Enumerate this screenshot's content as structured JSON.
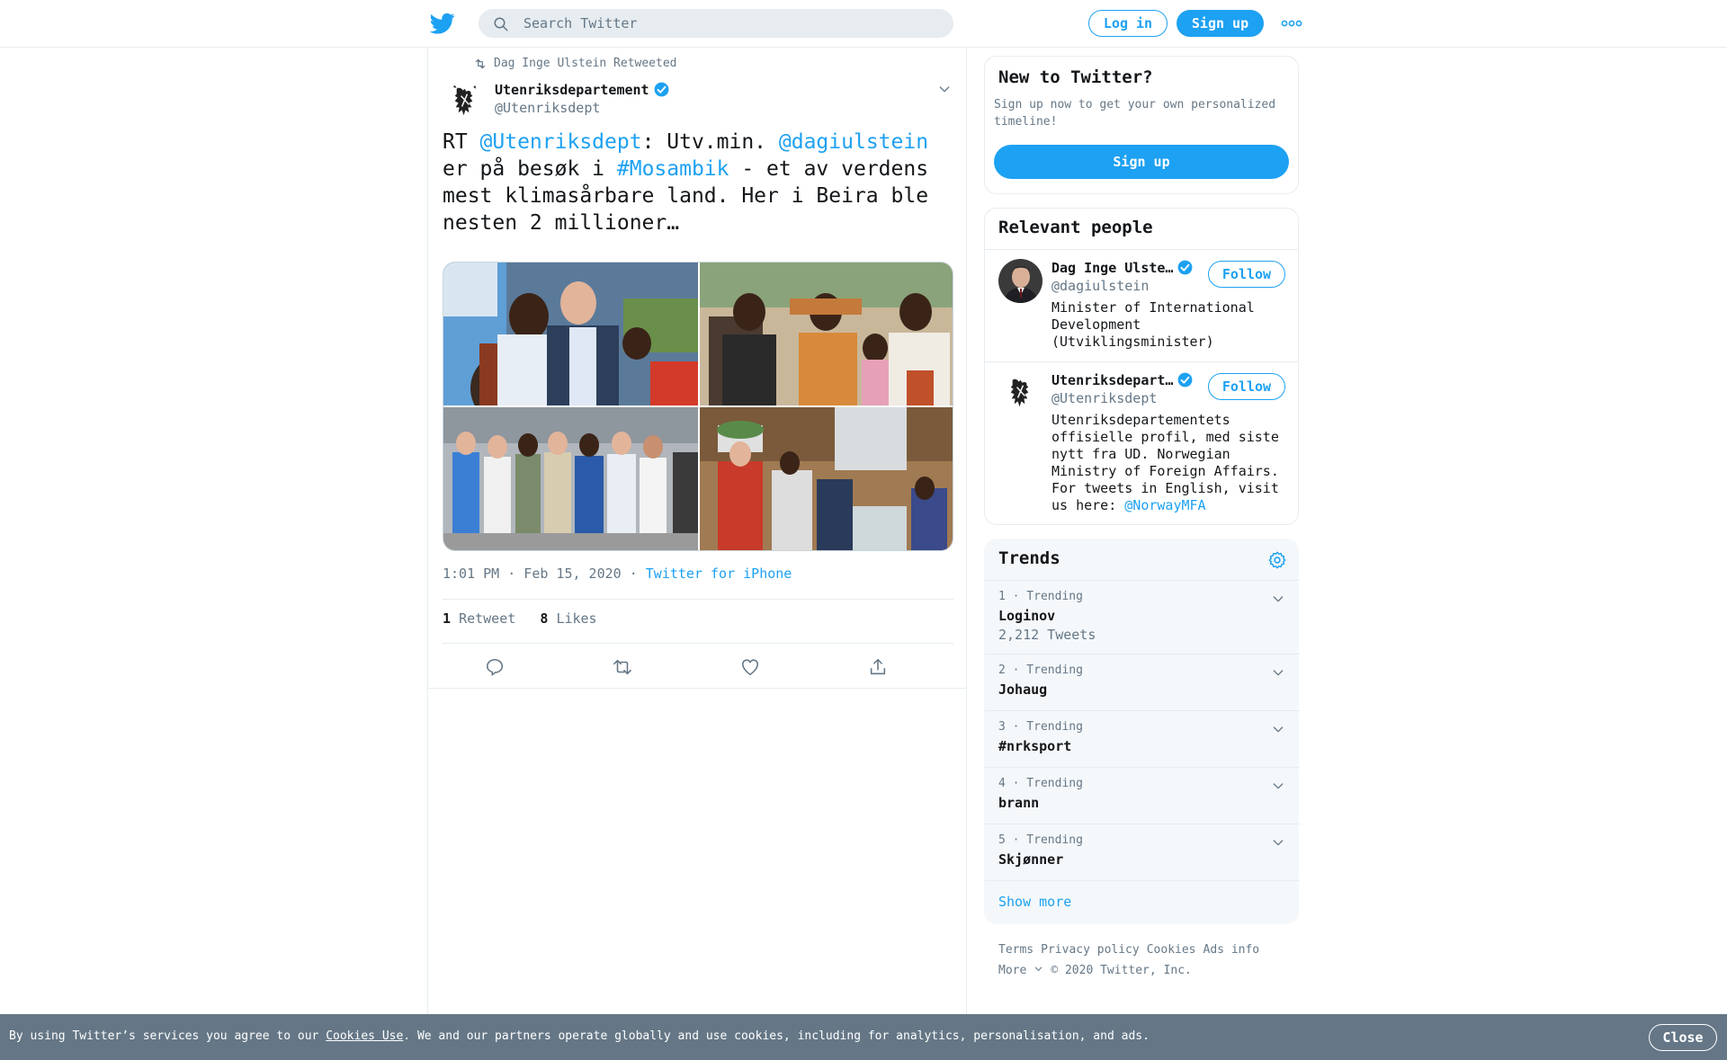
{
  "header": {
    "search_placeholder": "Search Twitter",
    "login_label": "Log in",
    "signup_label": "Sign up"
  },
  "tweet": {
    "retweeted_by": "Dag Inge Ulstein Retweeted",
    "author_name": "Utenriksdepartement",
    "author_handle": "@Utenriksdept",
    "text_parts": {
      "p1": "RT ",
      "m1": "@Utenriksdept",
      "p2": ": Utv.min. ",
      "m2": "@dagiulstein",
      "p3": " er på besøk i ",
      "h1": "#Mosambik",
      "p4": " - et av verdens mest klimasårbare land. Her i Beira ble nesten 2 millioner…"
    },
    "timestamp": "1:01 PM · Feb 15, 2020",
    "dot": "·",
    "source": "Twitter for iPhone",
    "retweet_count": "1",
    "retweet_label": "Retweet",
    "like_count": "8",
    "like_label": "Likes"
  },
  "new_to_twitter": {
    "title": "New to Twitter?",
    "text": "Sign up now to get your own personalized timeline!",
    "button": "Sign up"
  },
  "relevant": {
    "title": "Relevant people",
    "people": [
      {
        "name": "Dag Inge Ulste…",
        "handle": "@dagiulstein",
        "bio": "Minister of International Development (Utviklingsminister)",
        "follow": "Follow"
      },
      {
        "name": "Utenriksdepart…",
        "handle": "@Utenriksdept",
        "bio": "Utenriksdepartementets offisielle profil, med siste nytt fra UD. Norwegian Ministry of Foreign Affairs. For tweets in English, visit us here: ",
        "bio_link": "@NorwayMFA",
        "follow": "Follow"
      }
    ]
  },
  "trends": {
    "title": "Trends",
    "items": [
      {
        "meta": "1 · Trending",
        "name": "Loginov",
        "count": "2,212 Tweets"
      },
      {
        "meta": "2 · Trending",
        "name": "Johaug",
        "count": ""
      },
      {
        "meta": "3 · Trending",
        "name": "#nrksport",
        "count": ""
      },
      {
        "meta": "4 · Trending",
        "name": "brann",
        "count": ""
      },
      {
        "meta": "5 · Trending",
        "name": "Skjønner",
        "count": ""
      }
    ],
    "show_more": "Show more"
  },
  "footer": {
    "terms": "Terms",
    "privacy": "Privacy policy",
    "cookies": "Cookies",
    "ads": "Ads info",
    "more": "More",
    "copyright": "© 2020 Twitter, Inc."
  },
  "cookie_bar": {
    "text_before": "By using Twitter’s services you agree to our ",
    "link": "Cookies Use",
    "text_after": ". We and our partners operate globally and use cookies, including for analytics, personalisation, and ads.",
    "close": "Close"
  },
  "colors": {
    "brand_blue": "#1da1f2",
    "muted": "#657786",
    "border": "#e6ecf0"
  }
}
